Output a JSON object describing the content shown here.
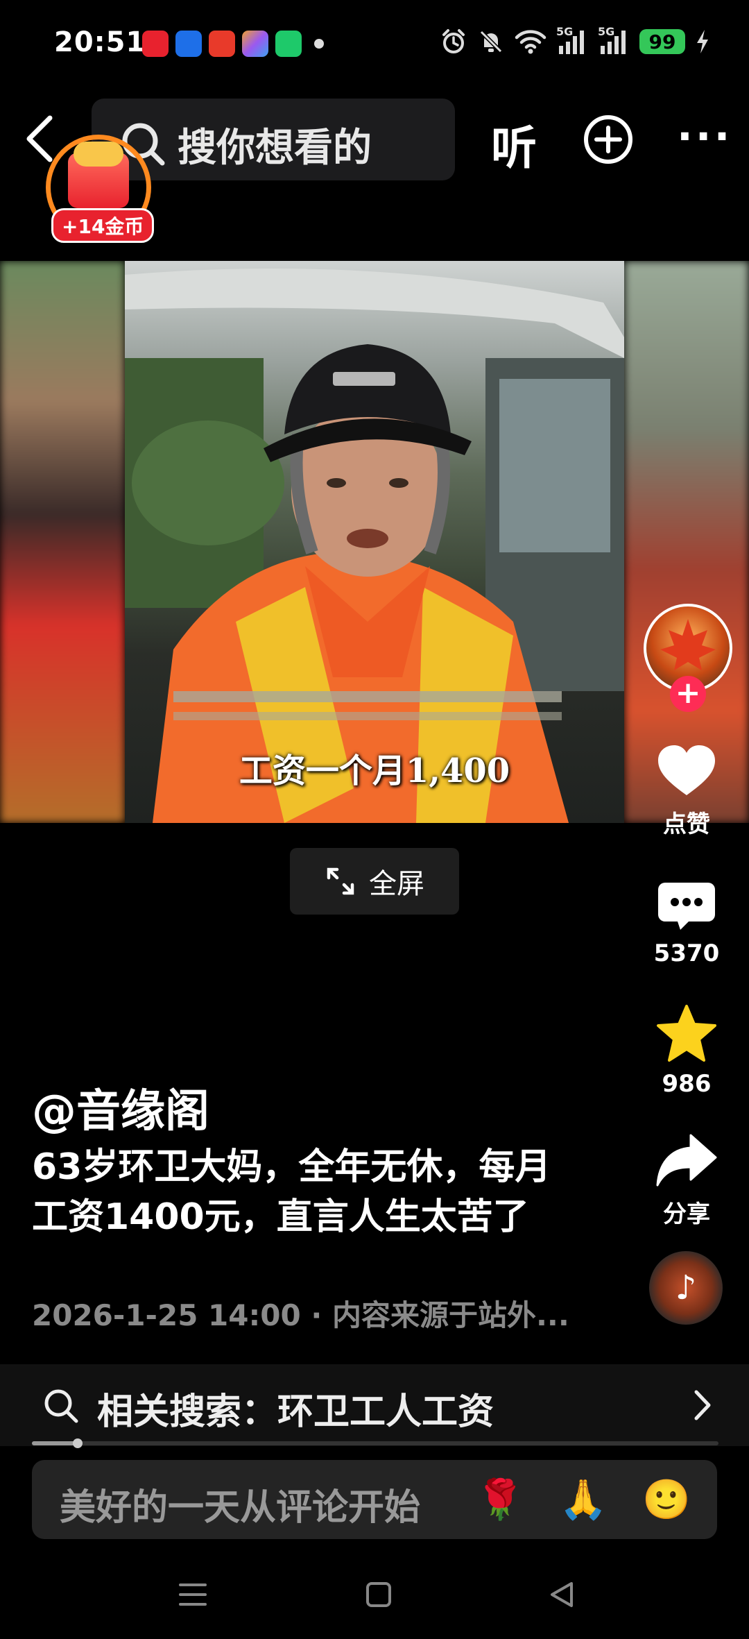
{
  "status_bar": {
    "time": "20:51",
    "app_icon_colors": [
      "#e8222e",
      "#1e6fe8",
      "#e83a2a",
      "#9b59f0",
      "#1ec96a"
    ],
    "network_1": "5G",
    "network_2": "5G",
    "battery": "99",
    "icons": [
      "alarm-icon",
      "mute-icon",
      "wifi-icon",
      "signal-icon",
      "signal-icon",
      "charging-icon"
    ]
  },
  "top_nav": {
    "search_placeholder": "搜你想看的",
    "listen_label": "听",
    "more_label": "···"
  },
  "coin_badge": {
    "label": "+14金币"
  },
  "video": {
    "subtitle": "工资一个月1,400"
  },
  "fullscreen": {
    "label": "全屏"
  },
  "actions": {
    "like_label": "点赞",
    "comment_count": "5370",
    "favorite_count": "986",
    "share_label": "分享"
  },
  "post": {
    "author": "@音缘阁",
    "caption": "63岁环卫大妈，全年无休，每月工资1400元，直言人生太苦了",
    "meta": "2026-1-25 14:00 · 内容来源于站外..."
  },
  "related_search": {
    "label": "相关搜索：环卫工人工资",
    "progress_fraction": 0.067
  },
  "comment": {
    "placeholder": "美好的一天从评论开始",
    "emojis": [
      "🌹",
      "🙏",
      "🙂"
    ]
  },
  "colors": {
    "accent_red": "#fe2c55",
    "star_yellow": "#fcd21d",
    "coin_orange": "#ff8a1f"
  }
}
